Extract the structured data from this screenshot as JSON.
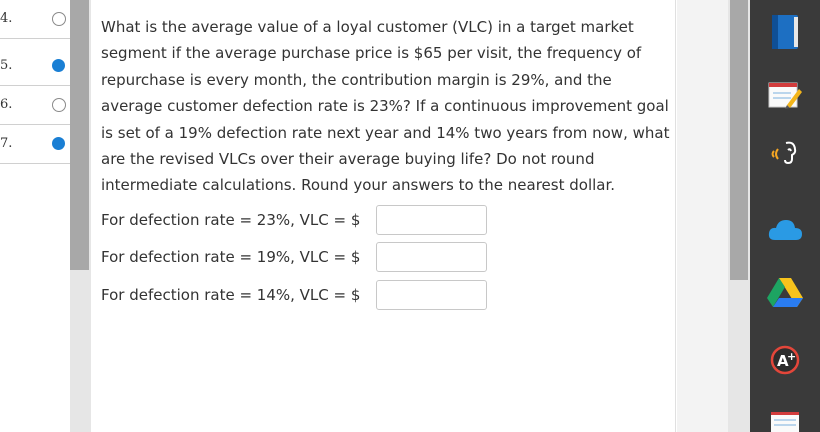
{
  "navigator": {
    "items": [
      {
        "number": "4.",
        "state": "unanswered"
      },
      {
        "number": "5.",
        "state": "answered"
      },
      {
        "number": "6.",
        "state": "unanswered"
      },
      {
        "number": "7.",
        "state": "answered"
      }
    ]
  },
  "question": {
    "text": "What is the average value of a loyal customer (VLC) in a target market segment if the average purchase price is $65 per visit, the frequency of repurchase is every month, the contribution margin is 29%, and the average customer defection rate is 23%? If a continuous improvement goal is set of a 19% defection rate next year and 14% two years from now, what are the revised VLCs over their average buying life? Do not round intermediate calculations. Round your answers to the nearest dollar."
  },
  "answers": [
    {
      "label": "For defection rate = 23%, VLC = $",
      "value": "",
      "placeholder": ""
    },
    {
      "label": "For defection rate = 19%, VLC = $",
      "value": "",
      "placeholder": ""
    },
    {
      "label": "For defection rate = 14%, VLC = $",
      "value": "",
      "placeholder": ""
    }
  ],
  "dock": {
    "apps": [
      "book-icon",
      "notepad-pencil-icon",
      "read-aloud-icon",
      "cloud-icon",
      "drive-icon",
      "grade-a-plus-icon",
      "notebook-icon"
    ]
  },
  "colors": {
    "accent_blue": "#1a7fd4",
    "dock_bg": "#3a3a3a",
    "scroll_thumb": "#a8a8a8"
  }
}
